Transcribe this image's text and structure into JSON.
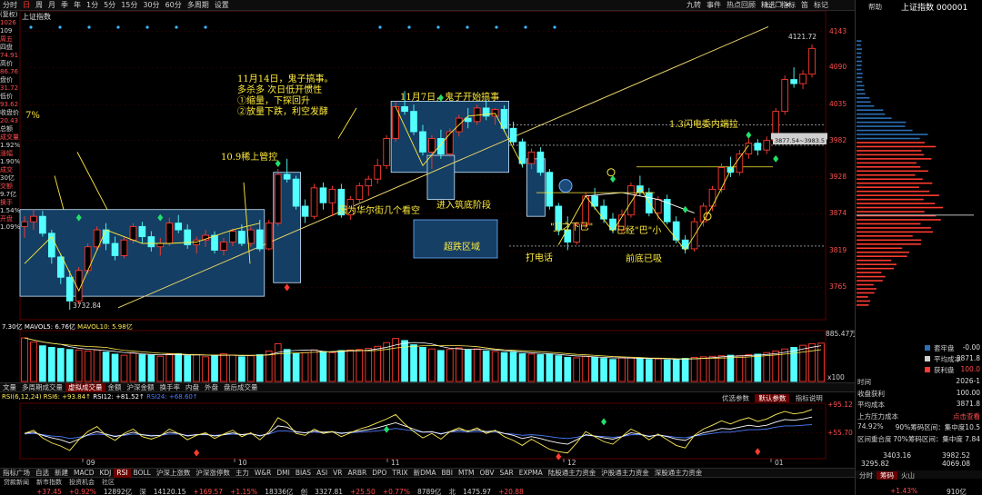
{
  "top_menu": {
    "items": [
      "分时",
      "日",
      "周",
      "月",
      "季",
      "年",
      "1分",
      "5分",
      "15分",
      "30分",
      "60分",
      "多周期",
      "设置"
    ],
    "active": "日",
    "right_items": [
      "九转",
      "事件",
      "热点回顾",
      "精选",
      "指标",
      "笛",
      "标记"
    ],
    "window_icons": [
      "minimize-icon",
      "restore-icon",
      "close-icon"
    ]
  },
  "chart_title": "上证指数",
  "left_info": [
    "(复权)",
    "1026",
    "109",
    "周五",
    "四盘",
    "74.91",
    "高价",
    "86.76",
    "盘价",
    "31.72",
    "低价",
    "93.62",
    "收盘价",
    "20.43",
    "总额",
    "成交量",
    "1.92%",
    "涨幅",
    "1.90%",
    "成交",
    "30亿",
    "交额",
    "9.7亿",
    "换手",
    "1.54%",
    "开盘",
    "1.09%"
  ],
  "chart_data": {
    "type": "candlestick",
    "title": "上证指数",
    "y_ticks": [
      4143,
      4090,
      4035,
      3982,
      3928,
      3874,
      3819,
      3765
    ],
    "ylim": [
      3720,
      4160
    ],
    "x_ticks": [
      "09",
      "10",
      "11",
      "12",
      "01"
    ],
    "price_labels": {
      "high": "4121.72",
      "low": "3732.84"
    },
    "candles": [
      [
        3855,
        3870,
        3838,
        3862
      ],
      [
        3862,
        3880,
        3850,
        3870
      ],
      [
        3870,
        3878,
        3840,
        3845
      ],
      [
        3845,
        3850,
        3800,
        3810
      ],
      [
        3810,
        3815,
        3770,
        3780
      ],
      [
        3780,
        3790,
        3732,
        3745
      ],
      [
        3745,
        3795,
        3740,
        3790
      ],
      [
        3790,
        3830,
        3785,
        3825
      ],
      [
        3825,
        3855,
        3820,
        3850
      ],
      [
        3850,
        3860,
        3820,
        3830
      ],
      [
        3830,
        3840,
        3805,
        3812
      ],
      [
        3812,
        3840,
        3808,
        3835
      ],
      [
        3835,
        3860,
        3830,
        3855
      ],
      [
        3855,
        3862,
        3830,
        3840
      ],
      [
        3840,
        3848,
        3818,
        3825
      ],
      [
        3825,
        3838,
        3812,
        3830
      ],
      [
        3830,
        3868,
        3826,
        3860
      ],
      [
        3860,
        3872,
        3845,
        3850
      ],
      [
        3850,
        3858,
        3822,
        3828
      ],
      [
        3828,
        3840,
        3815,
        3835
      ],
      [
        3835,
        3850,
        3825,
        3842
      ],
      [
        3842,
        3848,
        3815,
        3820
      ],
      [
        3820,
        3838,
        3812,
        3832
      ],
      [
        3832,
        3852,
        3826,
        3848
      ],
      [
        3848,
        3858,
        3826,
        3830
      ],
      [
        3830,
        3855,
        3825,
        3850
      ],
      [
        3850,
        3865,
        3818,
        3822
      ],
      [
        3822,
        3865,
        3820,
        3860
      ],
      [
        3860,
        3940,
        3856,
        3932
      ],
      [
        3932,
        3955,
        3920,
        3925
      ],
      [
        3925,
        3930,
        3880,
        3885
      ],
      [
        3885,
        3895,
        3860,
        3870
      ],
      [
        3870,
        3918,
        3866,
        3912
      ],
      [
        3912,
        3920,
        3880,
        3890
      ],
      [
        3890,
        3915,
        3870,
        3910
      ],
      [
        3910,
        3918,
        3868,
        3872
      ],
      [
        3872,
        3900,
        3865,
        3895
      ],
      [
        3895,
        3920,
        3888,
        3915
      ],
      [
        3915,
        3930,
        3900,
        3925
      ],
      [
        3925,
        3955,
        3918,
        3945
      ],
      [
        3945,
        3990,
        3940,
        3985
      ],
      [
        3985,
        4040,
        3980,
        4032
      ],
      [
        4032,
        4055,
        4020,
        4025
      ],
      [
        4025,
        4035,
        3990,
        3995
      ],
      [
        3995,
        4005,
        3960,
        3965
      ],
      [
        3965,
        3990,
        3940,
        3985
      ],
      [
        3985,
        3998,
        3955,
        3962
      ],
      [
        3962,
        4000,
        3958,
        3995
      ],
      [
        3995,
        4020,
        3988,
        4015
      ],
      [
        4015,
        4030,
        4000,
        4010
      ],
      [
        4010,
        4035,
        4005,
        4030
      ],
      [
        4030,
        4042,
        4012,
        4018
      ],
      [
        4018,
        4030,
        4005,
        4028
      ],
      [
        4028,
        4034,
        3995,
        4000
      ],
      [
        4000,
        4010,
        3975,
        3980
      ],
      [
        3980,
        3985,
        3942,
        3948
      ],
      [
        3948,
        3970,
        3940,
        3965
      ],
      [
        3965,
        3972,
        3930,
        3935
      ],
      [
        3935,
        3940,
        3880,
        3885
      ],
      [
        3885,
        3890,
        3842,
        3850
      ],
      [
        3850,
        3870,
        3820,
        3832
      ],
      [
        3832,
        3862,
        3828,
        3858
      ],
      [
        3858,
        3905,
        3852,
        3900
      ],
      [
        3900,
        3912,
        3880,
        3885
      ],
      [
        3885,
        3895,
        3860,
        3866
      ],
      [
        3866,
        3875,
        3845,
        3850
      ],
      [
        3850,
        3880,
        3845,
        3872
      ],
      [
        3872,
        3920,
        3868,
        3915
      ],
      [
        3915,
        3930,
        3900,
        3905
      ],
      [
        3905,
        3912,
        3870,
        3875
      ],
      [
        3875,
        3900,
        3865,
        3895
      ],
      [
        3895,
        3902,
        3858,
        3862
      ],
      [
        3862,
        3870,
        3830,
        3835
      ],
      [
        3835,
        3842,
        3815,
        3822
      ],
      [
        3822,
        3868,
        3818,
        3862
      ],
      [
        3862,
        3890,
        3855,
        3885
      ],
      [
        3885,
        3915,
        3878,
        3910
      ],
      [
        3910,
        3948,
        3905,
        3942
      ],
      [
        3942,
        3958,
        3928,
        3935
      ],
      [
        3935,
        3968,
        3930,
        3962
      ],
      [
        3962,
        3985,
        3955,
        3978
      ],
      [
        3978,
        3984,
        3960,
        3968
      ],
      [
        3968,
        3988,
        3962,
        3982
      ],
      [
        3982,
        4030,
        3978,
        4025
      ],
      [
        4025,
        4078,
        4020,
        4072
      ],
      [
        4072,
        4090,
        4060,
        4066
      ],
      [
        4066,
        4086,
        4058,
        4080
      ],
      [
        4080,
        4124,
        4075,
        4118
      ]
    ],
    "volume": {
      "label_left": "7.30亿",
      "legend": [
        "MAVOL5: 6.76亿",
        "MAVOL10: 5.98亿"
      ],
      "y_ticks": [
        "885.47万",
        "x100"
      ],
      "values": [
        8.3,
        7.5,
        6.8,
        6.5,
        6.3,
        6.1,
        6.0,
        5.8,
        6.0,
        5.6,
        5.2,
        5.0,
        5.4,
        5.1,
        5.0,
        4.8,
        5.2,
        5.3,
        4.9,
        5.1,
        4.7,
        4.9,
        5.3,
        5.0,
        4.7,
        4.9,
        5.1,
        5.8,
        7.2,
        6.1,
        5.3,
        5.5,
        6.0,
        5.7,
        5.5,
        5.9,
        6.0,
        6.1,
        6.3,
        6.7,
        7.4,
        8.2,
        7.8,
        7.0,
        6.5,
        6.2,
        5.9,
        6.1,
        6.4,
        6.0,
        6.2,
        5.8,
        5.7,
        5.5,
        5.6,
        5.3,
        5.2,
        5.1,
        5.2,
        4.9,
        4.6,
        4.5,
        4.8,
        4.6,
        4.4,
        4.2,
        4.5,
        4.6,
        4.4,
        4.2,
        4.3,
        4.1,
        4.2,
        4.4,
        4.6,
        4.7,
        4.8,
        4.9,
        5.0,
        4.9,
        5.1,
        5.2,
        5.5,
        5.8,
        6.2,
        6.5,
        6.9,
        7.2,
        7.3
      ],
      "rising": [
        1,
        1,
        0,
        0,
        0,
        0,
        1,
        1,
        1,
        0,
        0,
        1,
        1,
        0,
        0,
        1,
        1,
        0,
        0,
        1,
        1,
        0,
        1,
        1,
        0,
        1,
        0,
        1,
        1,
        0,
        0,
        1,
        1,
        0,
        1,
        0,
        1,
        1,
        1,
        1,
        1,
        1,
        0,
        0,
        0,
        1,
        0,
        1,
        1,
        0,
        1,
        0,
        1,
        0,
        0,
        0,
        1,
        0,
        0,
        0,
        0,
        1,
        1,
        0,
        0,
        0,
        1,
        1,
        0,
        0,
        1,
        0,
        0,
        0,
        1,
        1,
        1,
        1,
        0,
        1,
        1,
        0,
        1,
        1,
        1,
        0,
        1,
        1,
        1
      ]
    },
    "rsi": {
      "legend": [
        "RSI(6,12,24) RSI6: +93.84↑",
        "RSI12: +81.52↑",
        "RSI24: +68.60↑"
      ],
      "y_ticks": [
        "+95.12",
        "+55.70"
      ],
      "rsi6": [
        55,
        60,
        48,
        40,
        35,
        28,
        45,
        58,
        66,
        52,
        44,
        55,
        62,
        50,
        46,
        51,
        62,
        55,
        45,
        52,
        56,
        47,
        54,
        60,
        50,
        56,
        45,
        58,
        80,
        72,
        55,
        52,
        62,
        55,
        58,
        50,
        56,
        62,
        66,
        72,
        78,
        85,
        70,
        58,
        48,
        55,
        46,
        58,
        64,
        58,
        64,
        55,
        60,
        50,
        44,
        36,
        46,
        38,
        30,
        26,
        24,
        40,
        58,
        50,
        42,
        38,
        50,
        62,
        55,
        45,
        54,
        45,
        36,
        32,
        52,
        62,
        68,
        75,
        70,
        76,
        80,
        74,
        78,
        85,
        90,
        86,
        88,
        93
      ],
      "rsi12": [
        55,
        57,
        52,
        48,
        45,
        40,
        46,
        53,
        58,
        54,
        50,
        53,
        57,
        53,
        51,
        52,
        57,
        55,
        51,
        53,
        54,
        51,
        53,
        56,
        53,
        55,
        51,
        55,
        67,
        65,
        58,
        56,
        59,
        57,
        58,
        55,
        57,
        59,
        61,
        64,
        68,
        72,
        67,
        62,
        57,
        58,
        54,
        58,
        61,
        59,
        61,
        58,
        59,
        55,
        52,
        47,
        50,
        47,
        43,
        40,
        38,
        45,
        53,
        51,
        48,
        46,
        50,
        56,
        54,
        50,
        53,
        50,
        46,
        44,
        51,
        56,
        59,
        63,
        62,
        65,
        68,
        66,
        68,
        73,
        77,
        76,
        78,
        81
      ],
      "rsi24": [
        54,
        55,
        53,
        51,
        50,
        47,
        49,
        52,
        54,
        53,
        51,
        52,
        54,
        53,
        52,
        52,
        54,
        54,
        52,
        53,
        53,
        52,
        53,
        54,
        53,
        54,
        52,
        54,
        59,
        59,
        57,
        56,
        57,
        56,
        57,
        56,
        56,
        57,
        58,
        59,
        61,
        63,
        61,
        59,
        57,
        57,
        55,
        57,
        58,
        57,
        58,
        57,
        57,
        55,
        54,
        52,
        53,
        52,
        50,
        48,
        47,
        49,
        52,
        51,
        50,
        49,
        50,
        53,
        53,
        51,
        52,
        51,
        49,
        48,
        51,
        53,
        55,
        57,
        57,
        59,
        61,
        61,
        62,
        65,
        67,
        67,
        68,
        69
      ]
    }
  },
  "annotations": {
    "pct7": "7%",
    "rare_control": "10.9稀上管控",
    "nov14_title": "11月14日，鬼子搞事。",
    "nov14_line1": "多杀多   次日低开惯性",
    "nov14_line2": "①缩量，下探回升",
    "nov14_line3": "②放量下跌，利空发酵",
    "nov7": "11月7日，鬼子开始搞事",
    "wall_street": "因为华尔街几个看空",
    "bottom_building": "进入筑底阶段",
    "oversold": "超跌区域",
    "phone_call": "打电话",
    "jj_hint": "\"JJ之下已\"",
    "bottom_hint": "已经\"巴\"小",
    "front_bottom": "前底已吸",
    "flash_pull": "1.3闪电委内端拉",
    "cost_label": "3877.54~3983.5"
  },
  "indicator_tabs": {
    "items": [
      "文量",
      "多周期成交量",
      "虚拟成交量",
      "金额",
      "沪深金额",
      "换手率",
      "内盘",
      "外盘",
      "盘后成交量"
    ],
    "active": "虚拟成交量",
    "right_items": [
      "优选参数",
      "默认参数",
      "指标说明"
    ]
  },
  "bottom_tabs": {
    "items": [
      "指标广场",
      "自选",
      "新建",
      "MACD",
      "KDJ",
      "RSI",
      "BOLL",
      "沪深上涨数",
      "沪深涨停数",
      "主力",
      "W&R",
      "DMI",
      "BIAS",
      "ASI",
      "VR",
      "ARBR",
      "DPO",
      "TRIX",
      "新DMA",
      "BBI",
      "MTM",
      "OBV",
      "SAR",
      "EXPMA",
      "陆股通主力资金",
      "沪股通主力资金",
      "深股通主力资金"
    ],
    "active": "RSI",
    "news": [
      "贷款新闻",
      "新市指数",
      "投资机会",
      "社区"
    ]
  },
  "ticker": [
    "+37.45",
    "+0.92%",
    "12892亿",
    "深",
    "14120.15",
    "+169.57",
    "+1.15%",
    "18336亿",
    "创",
    "3327.81",
    "+25.50",
    "+0.77%",
    "8789亿",
    "北",
    "1475.97",
    "+20.88"
  ],
  "right_panel": {
    "title": "上证指数 000001",
    "help": "帮助",
    "legend": [
      {
        "name": "套牢盘",
        "value": "-0.00"
      },
      {
        "name": "平均成本",
        "value": "3871.8"
      },
      {
        "name": "获利盘",
        "value": "100.0"
      }
    ],
    "rows": [
      {
        "label": "时间",
        "value": "2026-1"
      },
      {
        "label": "收盘获利",
        "value": "100.00"
      },
      {
        "label": "平均成本",
        "value": "3871.8"
      },
      {
        "label": "上方压力成本",
        "value": "点击查看"
      },
      {
        "label": "74.92%",
        "value": "90%筹码区间：集中度10.5"
      },
      {
        "label": "区间重合度",
        "value": "70%筹码区间：集中度 7.84"
      }
    ],
    "cost_range": [
      "3403.16",
      "3982.52"
    ],
    "cost_range2": [
      "3295.82",
      "4069.08"
    ],
    "tabs": [
      "分时",
      "筹码",
      "火山"
    ],
    "active_tab": "筹码",
    "ticker_end": [
      "+1.43%",
      "910亿"
    ]
  },
  "colors": {
    "up": "#ff3b30",
    "down": "#54ffff",
    "box": "#1b4c78",
    "rsi6": "#ffee55",
    "rsi12": "#ffffff",
    "rsi24": "#4d7dff",
    "mavol5": "#ffffff",
    "mavol10": "#ffee55"
  }
}
